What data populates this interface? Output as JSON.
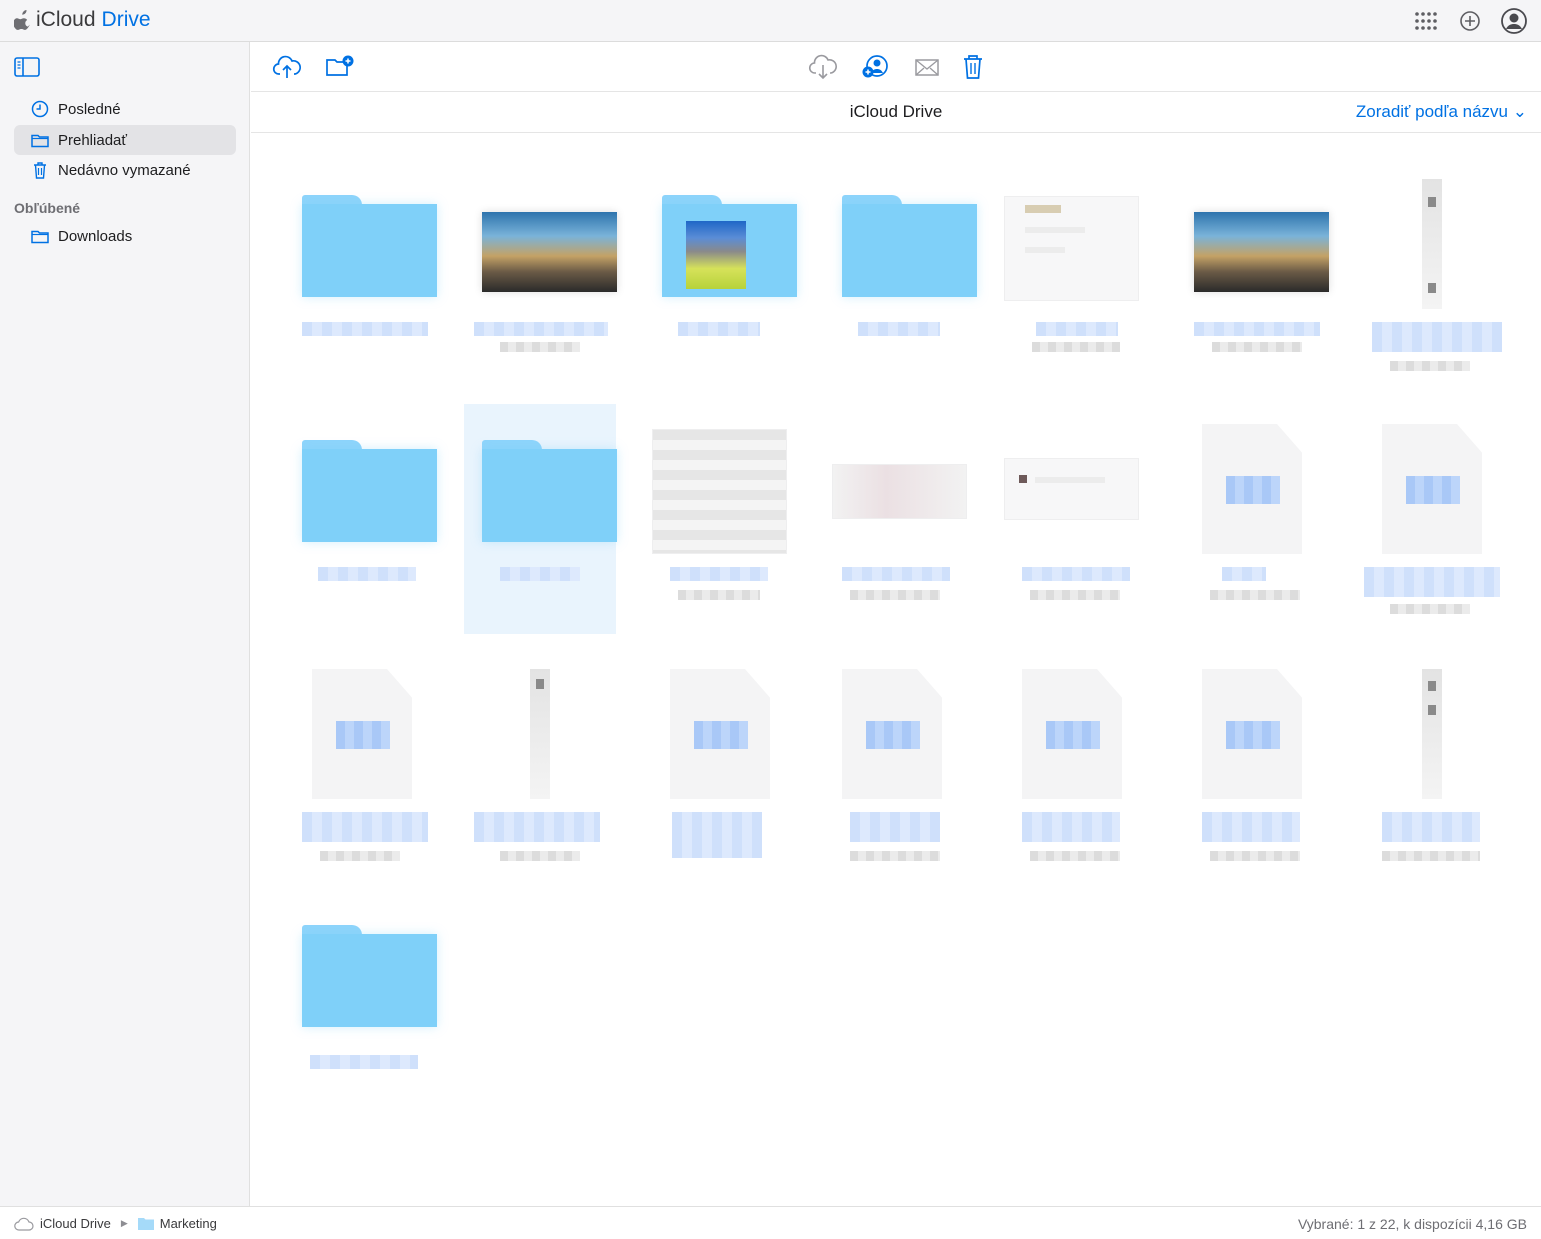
{
  "app": {
    "brand_plain": "iCloud",
    "brand_accent": "Drive"
  },
  "top_icons": [
    "apps-grid-icon",
    "plus-circle-icon",
    "account-icon"
  ],
  "sidebar": {
    "items": [
      {
        "label": "Posledné",
        "icon": "clock-icon"
      },
      {
        "label": "Prehliadať",
        "icon": "folder-icon",
        "active": true
      },
      {
        "label": "Nedávno vymazané",
        "icon": "trash-icon"
      }
    ],
    "favorites_heading": "Obľúbené",
    "favorites": [
      {
        "label": "Downloads",
        "icon": "folder-icon"
      }
    ]
  },
  "toolbar": {
    "left": [
      "upload-icon",
      "new-folder-icon"
    ],
    "center": [
      "download-icon",
      "share-person-icon",
      "mail-icon",
      "trash-icon"
    ]
  },
  "main": {
    "title": "iCloud Drive",
    "sort_label": "Zoradiť podľa názvu",
    "sort_chevron": "⌄"
  },
  "grid": {
    "rows": [
      [
        "folder",
        "image",
        "folder-with-image",
        "folder",
        "document",
        "image",
        "thin-file"
      ],
      [
        "folder",
        "folder-selected",
        "document",
        "document-wide",
        "document-wide",
        "pdf",
        "pdf"
      ],
      [
        "pdf",
        "thin-file",
        "pdf",
        "pdf",
        "pdf",
        "pdf",
        "thin-file"
      ],
      [
        "folder"
      ]
    ]
  },
  "footer": {
    "crumb_root": "iCloud Drive",
    "crumb_child": "Marketing",
    "status": "Vybrané: 1 z 22, k dispozícii 4,16 GB"
  },
  "colors": {
    "accent": "#0071e3",
    "folder": "#7fd0f9",
    "selection": "#e9f4fd"
  }
}
